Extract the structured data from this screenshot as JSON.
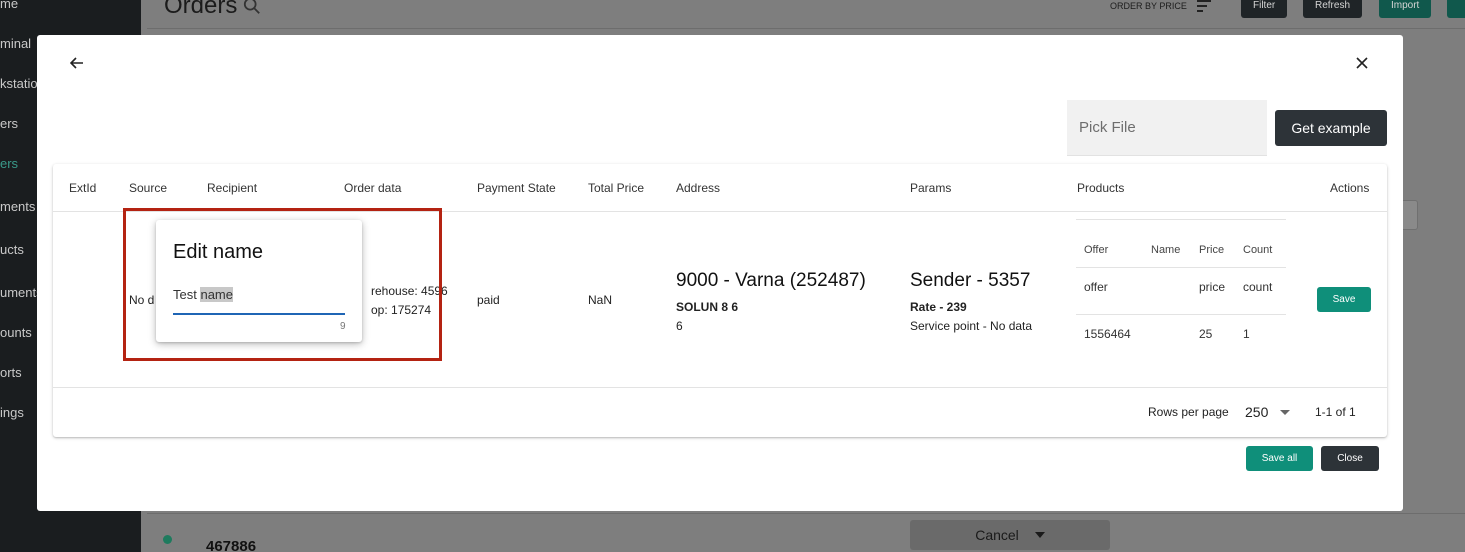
{
  "background": {
    "sidebar_items": [
      {
        "label": "me",
        "active": false
      },
      {
        "label": "minal",
        "active": false
      },
      {
        "label": "kstatio",
        "active": false
      },
      {
        "label": "ers",
        "active": false
      },
      {
        "label": "ers",
        "active": true
      },
      {
        "label": "ments",
        "active": false
      },
      {
        "label": "ucts",
        "active": false
      },
      {
        "label": "uments",
        "active": false
      },
      {
        "label": "ounts",
        "active": false
      },
      {
        "label": "orts",
        "active": false
      },
      {
        "label": "ings",
        "active": false
      }
    ],
    "page_title": "Orders",
    "order_by_label": "ORDER BY PRICE",
    "buttons": {
      "filter": "Filter",
      "refresh": "Refresh",
      "import": "Import"
    },
    "order_id": "467886",
    "cancel_label": "Cancel"
  },
  "dialog": {
    "pick_file_placeholder": "Pick File",
    "get_example_label": "Get example",
    "table": {
      "headers": {
        "extid": "ExtId",
        "source": "Source",
        "recipient": "Recipient",
        "order_data": "Order data",
        "payment_state": "Payment State",
        "total_price": "Total Price",
        "address": "Address",
        "params": "Params",
        "products": "Products",
        "actions": "Actions"
      },
      "row": {
        "source": "No d",
        "order_data_line1": "rehouse: 4596",
        "order_data_line2": "op: 175274",
        "payment_state": "paid",
        "total_price": "NaN",
        "address_title": "9000 - Varna (252487)",
        "address_street": "SOLUN 8 6",
        "address_extra": "6",
        "params_title": "Sender - 5357",
        "params_rate": "Rate - 239",
        "params_service": "Service point - No data",
        "products": {
          "headers": {
            "offer": "Offer",
            "name": "Name",
            "price": "Price",
            "count": "Count"
          },
          "rows": [
            {
              "offer": "offer",
              "name": "",
              "price": "price",
              "count": "count"
            },
            {
              "offer": "1556464",
              "name": "",
              "price": "25",
              "count": "1"
            }
          ]
        },
        "save_label": "Save"
      },
      "footer": {
        "rows_per_page_label": "Rows per page",
        "rows_per_page_value": "250",
        "range": "1-1 of 1"
      }
    },
    "save_all_label": "Save all",
    "close_label": "Close"
  },
  "edit_popup": {
    "title": "Edit name",
    "input_prefix": "Test ",
    "input_selected": "name",
    "char_count": "9"
  },
  "colors": {
    "accent": "#0f8f7a",
    "dark_button": "#2d3338",
    "highlight_border": "#b42312",
    "input_underline": "#1f65b5"
  }
}
